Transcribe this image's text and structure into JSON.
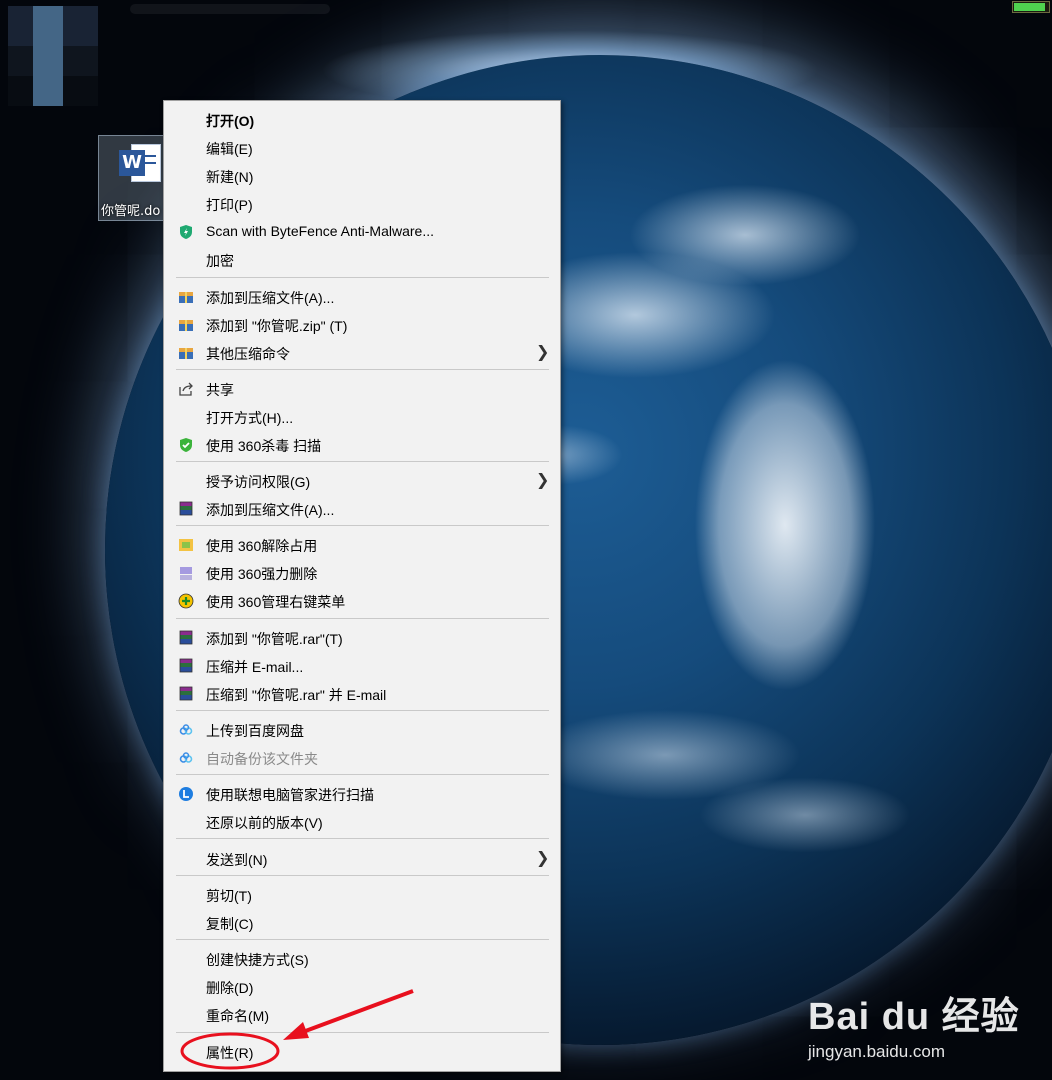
{
  "desktop": {
    "file_label": "你管呢.do",
    "battery_level": 0.92
  },
  "context_menu": {
    "items": [
      {
        "label": "打开(O)",
        "icon": "none",
        "bold": true
      },
      {
        "label": "编辑(E)",
        "icon": "none"
      },
      {
        "label": "新建(N)",
        "icon": "none"
      },
      {
        "label": "打印(P)",
        "icon": "none"
      },
      {
        "label": "Scan with ByteFence Anti-Malware...",
        "icon": "bytefence-shield-icon"
      },
      {
        "label": "加密",
        "icon": "none"
      },
      {
        "label": "添加到压缩文件(A)...",
        "icon": "archive-icon"
      },
      {
        "label": "添加到 \"你管呢.zip\" (T)",
        "icon": "archive-icon"
      },
      {
        "label": "其他压缩命令",
        "icon": "archive-icon",
        "submenu": true
      },
      {
        "label": "共享",
        "icon": "share-icon"
      },
      {
        "label": "打开方式(H)...",
        "icon": "none"
      },
      {
        "label": "使用 360杀毒 扫描",
        "icon": "360-antivirus-icon"
      },
      {
        "label": "授予访问权限(G)",
        "icon": "none",
        "submenu": true
      },
      {
        "label": "添加到压缩文件(A)...",
        "icon": "winrar-icon"
      },
      {
        "label": "使用 360解除占用",
        "icon": "360-unlock-icon"
      },
      {
        "label": "使用 360强力删除",
        "icon": "360-shred-icon"
      },
      {
        "label": "使用 360管理右键菜单",
        "icon": "360-menu-manager-icon"
      },
      {
        "label": "添加到 \"你管呢.rar\"(T)",
        "icon": "winrar-icon"
      },
      {
        "label": "压缩并 E-mail...",
        "icon": "winrar-icon"
      },
      {
        "label": "压缩到 \"你管呢.rar\" 并 E-mail",
        "icon": "winrar-icon"
      },
      {
        "label": "上传到百度网盘",
        "icon": "baidu-netdisk-icon"
      },
      {
        "label": "自动备份该文件夹",
        "icon": "baidu-netdisk-icon",
        "disabled": true
      },
      {
        "label": "使用联想电脑管家进行扫描",
        "icon": "lenovo-manager-icon"
      },
      {
        "label": "还原以前的版本(V)",
        "icon": "none"
      },
      {
        "label": "发送到(N)",
        "icon": "none",
        "submenu": true
      },
      {
        "label": "剪切(T)",
        "icon": "none"
      },
      {
        "label": "复制(C)",
        "icon": "none"
      },
      {
        "label": "创建快捷方式(S)",
        "icon": "none"
      },
      {
        "label": "删除(D)",
        "icon": "none"
      },
      {
        "label": "重命名(M)",
        "icon": "none"
      },
      {
        "label": "属性(R)",
        "icon": "none",
        "highlighted_by_annotation": true
      }
    ],
    "submenu_arrow": "❯"
  },
  "annotation": {
    "color": "#e8101e",
    "marks": [
      "circle around 属性(R)",
      "arrow pointing to 属性(R)"
    ]
  },
  "watermark": {
    "logo": "Bai du 经验",
    "url": "jingyan.baidu.com"
  }
}
